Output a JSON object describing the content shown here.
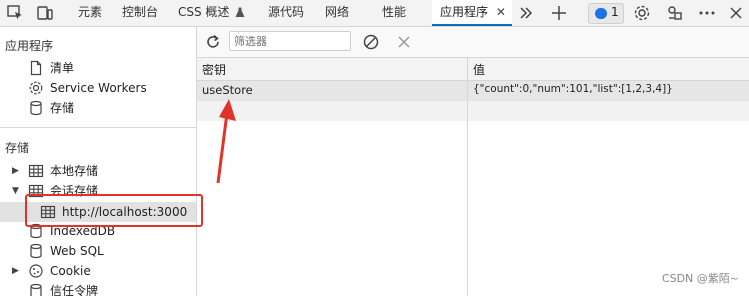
{
  "toolbar_tabs": {
    "elements": "元素",
    "console": "控制台",
    "css_overview": "CSS 概述",
    "sources": "源代码",
    "network": "网络",
    "performance": "性能",
    "application": "应用程序",
    "issues_count": "1"
  },
  "sidebar": {
    "application_title": "应用程序",
    "manifest": "清单",
    "service_workers": "Service Workers",
    "storage_item": "存储",
    "storage_title": "存储",
    "local_storage": "本地存储",
    "session_storage": "会话存储",
    "session_host": "http://localhost:3000",
    "indexeddb": "IndexedDB",
    "websql": "Web SQL",
    "cookie": "Cookie",
    "trust_tokens": "信任令牌"
  },
  "main": {
    "filter_placeholder": "筛选器",
    "col_key": "密钥",
    "col_value": "值",
    "rows": [
      {
        "key": "useStore",
        "value": "{\"count\":0,\"num\":101,\"list\":[1,2,3,4]}"
      }
    ]
  },
  "watermark": "CSDN @紫陌~",
  "colors": {
    "accent": "#0f6cbd",
    "annotation_red": "#e0342b",
    "selected_row": "#e1e1e1"
  }
}
